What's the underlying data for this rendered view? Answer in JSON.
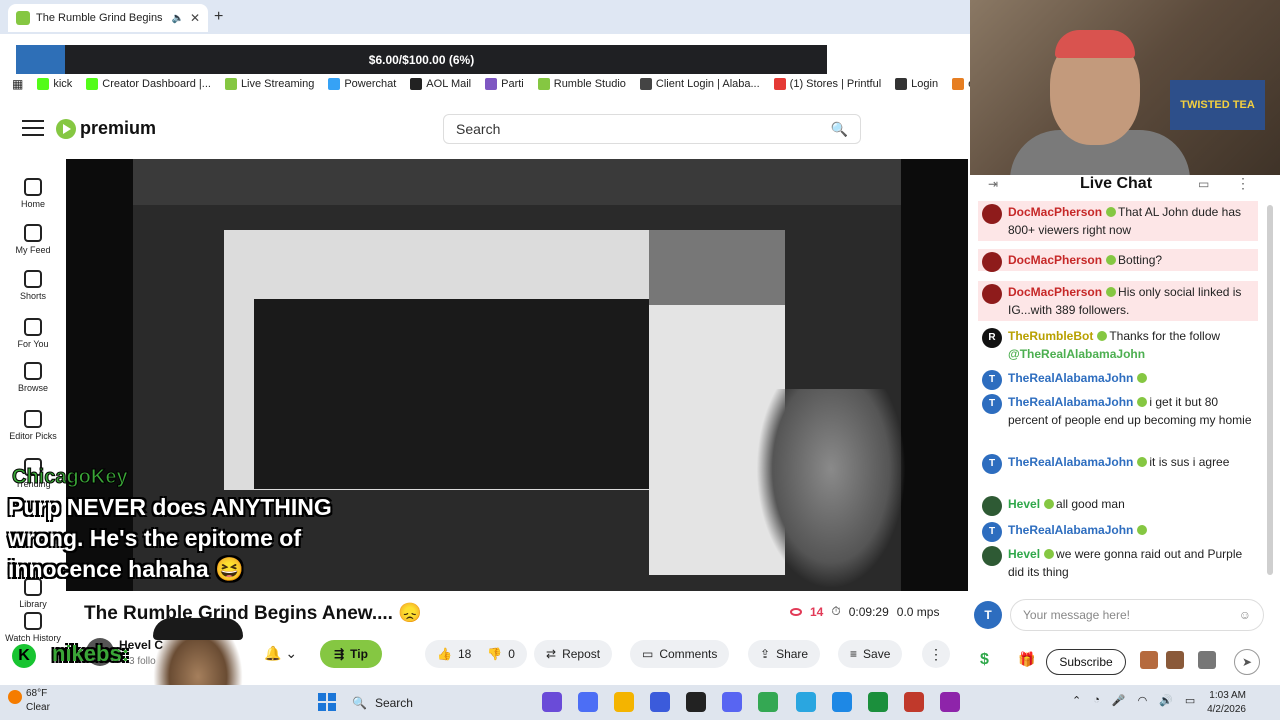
{
  "browser": {
    "tab_title": "The Rumble Grind Begins A",
    "new_tab_symbol": "+",
    "progress_label": "$6.00/$100.00 (6%)",
    "progress_fraction": 0.06,
    "bookmarks": [
      {
        "label": "kick",
        "color": "#53fc18"
      },
      {
        "label": "Creator Dashboard |...",
        "color": "#53fc18"
      },
      {
        "label": "Live Streaming",
        "color": "#85c742"
      },
      {
        "label": "Powerchat",
        "color": "#36a2f5"
      },
      {
        "label": "AOL Mail",
        "color": "#222222"
      },
      {
        "label": "Parti",
        "color": "#7e57c2"
      },
      {
        "label": "Rumble Studio",
        "color": "#85c742"
      },
      {
        "label": "Client Login | Alaba...",
        "color": "#444444"
      },
      {
        "label": "(1) Stores | Printful",
        "color": "#e53935"
      },
      {
        "label": "Login",
        "color": "#333333"
      },
      {
        "label": "ezgif.co",
        "color": "#e67e22"
      }
    ]
  },
  "header": {
    "logo_text": "premium",
    "search_placeholder": "Search"
  },
  "nav": {
    "items": [
      {
        "label": "Home",
        "icon": "home-icon"
      },
      {
        "label": "My Feed",
        "icon": "feed-icon"
      },
      {
        "label": "Shorts",
        "icon": "shorts-icon"
      },
      {
        "label": "For You",
        "icon": "for-you-icon"
      },
      {
        "label": "Browse",
        "icon": "browse-icon"
      },
      {
        "label": "Editor Picks",
        "icon": "editor-picks-icon"
      },
      {
        "label": "Trending",
        "icon": "trending-icon"
      },
      {
        "label": "Library",
        "icon": "library-icon"
      },
      {
        "label": "Watch History",
        "icon": "history-icon"
      }
    ]
  },
  "overlay": {
    "chat_user": "ChicagoKey",
    "chat_message": "Purp NEVER does ANYTHING wrong. He's the epitome of innocence hahaha 😆",
    "badge_letter": "K",
    "follower_name": "nikebs:"
  },
  "video": {
    "title": "The Rumble Grind Begins Anew.... 😞",
    "viewers": "14",
    "elapsed": "0:09:29",
    "mps": "0.0 mps"
  },
  "channel": {
    "name": "Hevel C",
    "followers": "3 follo"
  },
  "actions": {
    "tip": "Tip",
    "likes": "18",
    "dislikes": "0",
    "repost": "Repost",
    "comments": "Comments",
    "share": "Share",
    "save": "Save"
  },
  "webcam": {
    "sign_text": "TWISTED TEA"
  },
  "chat": {
    "title": "Live Chat",
    "messages": [
      {
        "name": "DocMacPherson",
        "text": "That AL John dude has 800+ viewers right now",
        "color": "#c62828",
        "avatar_color": "#8e1b1b",
        "avatar_text": ""
      },
      {
        "name": "DocMacPherson",
        "text": "Botting?",
        "color": "#c62828",
        "avatar_color": "#8e1b1b",
        "avatar_text": ""
      },
      {
        "name": "DocMacPherson",
        "text": "His only social linked is IG...with 389 followers.",
        "color": "#c62828",
        "avatar_color": "#8e1b1b",
        "avatar_text": ""
      },
      {
        "name": "TheRumbleBot",
        "text": "Thanks for the follow",
        "mention": "@TheRealAlabamaJohn",
        "color": "#b8a000",
        "avatar_color": "#111111",
        "avatar_text": "R"
      },
      {
        "name": "TheRealAlabamaJohn",
        "text": "",
        "color": "#2d6dbf",
        "avatar_color": "#2d6dbf",
        "avatar_text": "T"
      },
      {
        "name": "TheRealAlabamaJohn",
        "text": "i get it but 80 percent of people end up becoming my homie",
        "color": "#2d6dbf",
        "avatar_color": "#2d6dbf",
        "avatar_text": "T"
      },
      {
        "name": "TheRealAlabamaJohn",
        "text": "it is sus i agree",
        "color": "#2d6dbf",
        "avatar_color": "#2d6dbf",
        "avatar_text": "T"
      },
      {
        "name": "Hevel",
        "text": "all good man",
        "color": "#2fa84a",
        "avatar_color": "#2e5a34",
        "avatar_text": ""
      },
      {
        "name": "TheRealAlabamaJohn",
        "text": "",
        "color": "#2d6dbf",
        "avatar_color": "#2d6dbf",
        "avatar_text": "T"
      },
      {
        "name": "Hevel",
        "text": "we were gonna raid out and Purple did its thing",
        "color": "#2fa84a",
        "avatar_color": "#2e5a34",
        "avatar_text": ""
      }
    ],
    "composer_avatar": "T",
    "composer_placeholder": "Your message here!",
    "subscribe": "Subscribe"
  },
  "taskbar": {
    "temp": "68°F",
    "condition": "Clear",
    "search": "Search",
    "time": "1:03 AM",
    "date": "4/2/2026"
  }
}
